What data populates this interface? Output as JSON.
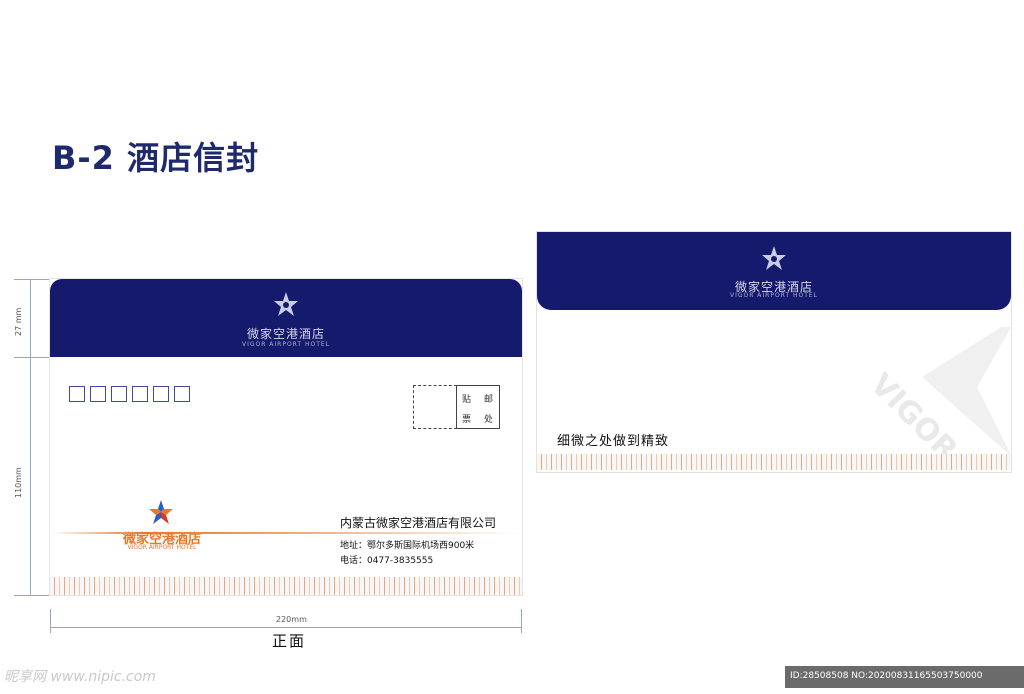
{
  "title": "B-2 酒店信封",
  "dimensions": {
    "height_flap": "27 mm",
    "height_body": "110mm",
    "width": "220mm"
  },
  "front": {
    "flap_brand_cn": "微家空港酒店",
    "flap_brand_en": "VIGOR AIRPORT HOTEL",
    "stamp_chars": [
      "贴",
      "邮",
      "票",
      "处"
    ],
    "logo_brand_cn": "微家空港酒店",
    "logo_brand_en": "VIGOR AIRPORT HOTEL",
    "company": "内蒙古微家空港酒店有限公司",
    "address": "地址：鄂尔多斯国际机场西900米",
    "phone": "电话：0477-3835555",
    "label": "正面"
  },
  "back": {
    "flap_brand_cn": "微家空港酒店",
    "flap_brand_en": "VIGOR AIRPORT HOTEL",
    "watermark_text": "VIGOR",
    "slogan": "细微之处做到精致"
  },
  "footer": {
    "watermark": "昵享网 www.nipic.com",
    "id_text": "ID:28508508 NO:20200831165503750000"
  },
  "colors": {
    "navy": "#161a6c",
    "orange": "#e8772a",
    "title": "#1f2a6d"
  }
}
